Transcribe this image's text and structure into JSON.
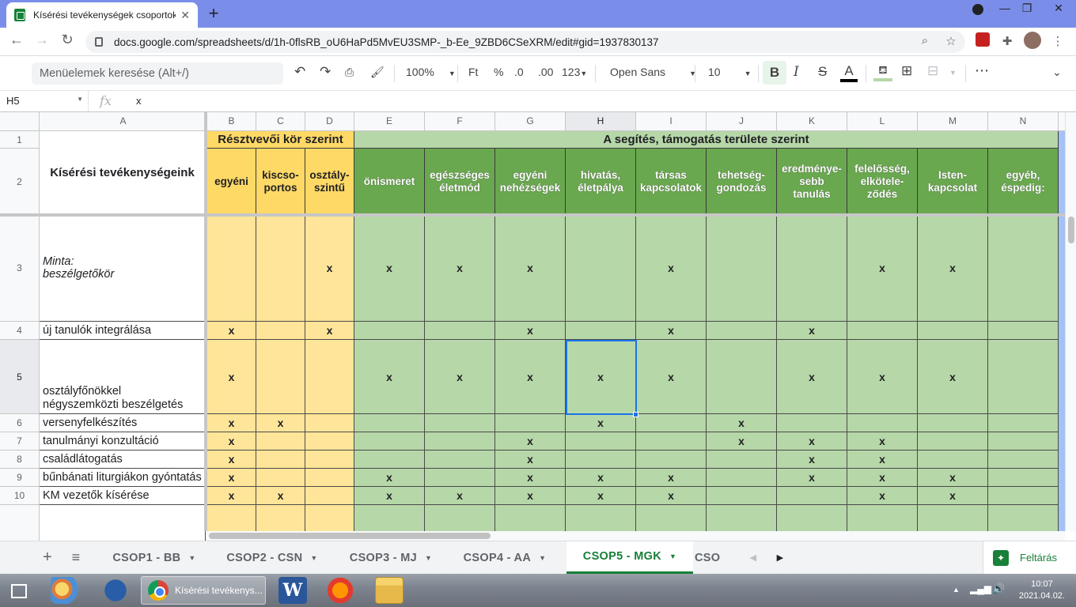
{
  "browser": {
    "tab_title": "Kísérési tevékenységek csoportok",
    "new_tab": "+",
    "url": "docs.google.com/spreadsheets/d/1h-0flsRB_oU6HaPd5MvEU3SMP-_b-Ee_9ZBD6CSeXRM/edit#gid=1937830137"
  },
  "toolbar": {
    "menu_search_placeholder": "Menüelemek keresése (Alt+/)",
    "zoom": "100%",
    "currency": "Ft",
    "percent": "%",
    "dec_decrease": ".0",
    "dec_increase": ".00",
    "number_format": "123",
    "font": "Open Sans",
    "font_size": "10",
    "bold": "B",
    "italic": "I",
    "strike": "S",
    "text_color": "A",
    "more": "⋯"
  },
  "formula_bar": {
    "cell_ref": "H5",
    "fx": "fx",
    "value": "x"
  },
  "grid": {
    "columns": [
      "A",
      "B",
      "C",
      "D",
      "E",
      "F",
      "G",
      "H",
      "I",
      "J",
      "K",
      "L",
      "M",
      "N"
    ],
    "rows": [
      "1",
      "2",
      "3",
      "4",
      "5",
      "6",
      "7",
      "8",
      "9",
      "10"
    ],
    "header_main": "Kísérési tevékenységeink",
    "group1_title": "Résztvevői kör szerint",
    "group2_title": "A segítés, támogatás területe szerint",
    "group1_cols": [
      "egyéni",
      "kiscso-\nportos",
      "osztály-\nszintű"
    ],
    "group2_cols": [
      "önismeret",
      "egészséges\néletmód",
      "egyéni\nnehézségek",
      "hivatás,\néletpálya",
      "társas\nkapcsolatok",
      "tehetség-\ngondozás",
      "eredménye-\nsebb\ntanulás",
      "felelősség,\nelkötele-\nződés",
      "Isten-\nkapcsolat",
      "egyéb,\néspedig:"
    ],
    "activities": [
      "Minta:\nbeszélgetőkör",
      "új tanulók integrálása",
      "osztályfőnökkel\nnégyszemközti beszélgetés",
      "versenyfelkészítés",
      "tanulmányi konzultáció",
      "családlátogatás",
      "bűnbánati liturgiákon gyóntatás",
      "KM vezetők kísérése"
    ],
    "mark": "x",
    "marks": [
      [
        0,
        0,
        1,
        1,
        1,
        1,
        0,
        1,
        0,
        0,
        1,
        1,
        0
      ],
      [
        1,
        0,
        1,
        0,
        0,
        1,
        0,
        1,
        0,
        1,
        0,
        0,
        0
      ],
      [
        1,
        0,
        0,
        1,
        1,
        1,
        1,
        1,
        0,
        1,
        1,
        1,
        0
      ],
      [
        1,
        1,
        0,
        0,
        0,
        0,
        1,
        0,
        1,
        0,
        0,
        0,
        0
      ],
      [
        1,
        0,
        0,
        0,
        0,
        1,
        0,
        0,
        1,
        1,
        1,
        0,
        0
      ],
      [
        1,
        0,
        0,
        0,
        0,
        1,
        0,
        0,
        0,
        1,
        1,
        0,
        0
      ],
      [
        1,
        0,
        0,
        1,
        0,
        1,
        1,
        1,
        0,
        1,
        1,
        1,
        0
      ],
      [
        1,
        1,
        0,
        1,
        1,
        1,
        1,
        1,
        0,
        0,
        1,
        1,
        0
      ]
    ]
  },
  "sheets": {
    "add": "+",
    "list": "≡",
    "tabs": [
      "CSOP1 - BB",
      "CSOP2 - CSN",
      "CSOP3 - MJ",
      "CSOP4 - AA",
      "CSOP5 - MGK",
      "CSO"
    ],
    "active": "CSOP5 - MGK",
    "explore": "Feltárás"
  },
  "taskbar": {
    "chrome_label": "Kísérési tevékenys...",
    "time": "10:07",
    "date": "2021.04.02."
  }
}
